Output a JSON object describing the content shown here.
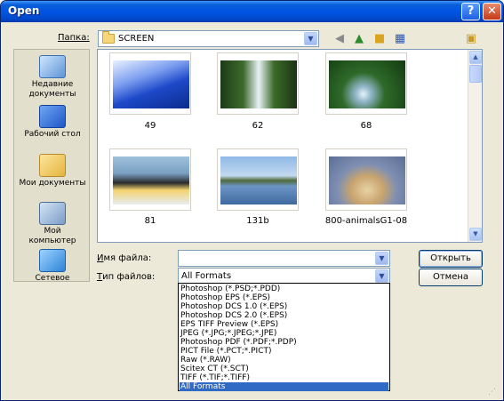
{
  "window": {
    "title": "Open",
    "help_label": "?",
    "close_label": "✕"
  },
  "lookin": {
    "label": "Папка:",
    "value": "SCREEN"
  },
  "toolbar": {
    "back_icon": "back-arrow-icon",
    "up_icon": "up-folder-icon",
    "new_folder_icon": "new-folder-icon",
    "views_icon": "views-menu-icon",
    "extra_icon": "folder-tools-icon"
  },
  "places": [
    {
      "label_line1": "Недавние",
      "label_line2": "документы",
      "icon": "recent-documents-icon"
    },
    {
      "label_line1": "Рабочий стол",
      "label_line2": "",
      "icon": "desktop-icon"
    },
    {
      "label_line1": "Мои документы",
      "label_line2": "",
      "icon": "my-documents-icon"
    },
    {
      "label_line1": "Мой",
      "label_line2": "компьютер",
      "icon": "my-computer-icon"
    },
    {
      "label_line1": "Сетевое",
      "label_line2": "",
      "icon": "network-places-icon"
    }
  ],
  "files": [
    {
      "name": "49"
    },
    {
      "name": "62"
    },
    {
      "name": "68"
    },
    {
      "name": "81"
    },
    {
      "name": "131b"
    },
    {
      "name": "800-animalsG1-08"
    }
  ],
  "filename": {
    "label_u": "И",
    "label_rest": "мя файла:",
    "value": ""
  },
  "filetype": {
    "label_u": "Т",
    "label_rest": "ип файлов:",
    "value": "All Formats"
  },
  "buttons": {
    "open": "Открыть",
    "cancel": "Отмена"
  },
  "format_options": [
    "Photoshop (*.PSD;*.PDD)",
    "Photoshop EPS (*.EPS)",
    "Photoshop DCS 1.0 (*.EPS)",
    "Photoshop DCS 2.0 (*.EPS)",
    "EPS TIFF Preview (*.EPS)",
    "JPEG (*.JPG;*.JPEG;*.JPE)",
    "Photoshop PDF (*.PDF;*.PDP)",
    "PICT File (*.PCT;*.PICT)",
    "Raw (*.RAW)",
    "Scitex CT (*.SCT)",
    "TIFF (*.TIF;*.TIFF)",
    "All Formats"
  ],
  "selected_format": "All Formats",
  "colors": {
    "title_blue": "#0055e5",
    "selection": "#316ac5",
    "dialog_bg": "#ece9d8"
  }
}
